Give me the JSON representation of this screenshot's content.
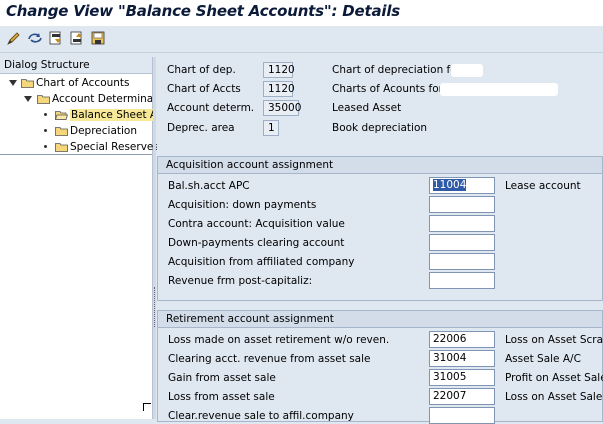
{
  "title": "Change View \"Balance Sheet Accounts\": Details",
  "toolbar": {
    "icons": [
      "edit-pencil-icon",
      "other-entry-icon",
      "previous-entry-icon",
      "next-entry-icon",
      "save-variant-icon"
    ]
  },
  "dialog": {
    "header": "Dialog Structure",
    "tree": [
      {
        "label": "Chart of Accounts"
      },
      {
        "label": "Account Determinati"
      },
      {
        "label": "Balance Sheet Ac"
      },
      {
        "label": "Depreciation"
      },
      {
        "label": "Special Reserves"
      }
    ]
  },
  "header_fields": [
    {
      "label": "Chart of dep.",
      "value": "1120",
      "desc": "Chart of depreciation for"
    },
    {
      "label": "Chart of Accts",
      "value": "1120",
      "desc": "Charts of Acounts for"
    },
    {
      "label": "Account determ.",
      "value": "35000",
      "desc": "Leased Asset"
    },
    {
      "label": "Deprec. area",
      "value": "1",
      "desc": "Book depreciation"
    }
  ],
  "acquisition": {
    "title": "Acquisition account assignment",
    "rows": [
      {
        "label": "Bal.sh.acct APC",
        "value": "11004",
        "desc": "Lease account"
      },
      {
        "label": "Acquisition: down payments",
        "value": "",
        "desc": ""
      },
      {
        "label": "Contra account: Acquisition value",
        "value": "",
        "desc": ""
      },
      {
        "label": "Down-payments clearing account",
        "value": "",
        "desc": ""
      },
      {
        "label": "Acquisition from affiliated company",
        "value": "",
        "desc": ""
      },
      {
        "label": "Revenue frm post-capitaliz:",
        "value": "",
        "desc": ""
      }
    ]
  },
  "retirement": {
    "title": "Retirement account assignment",
    "rows": [
      {
        "label": "Loss made on asset retirement w/o reven.",
        "value": "22006",
        "desc": "Loss on Asset Scrap"
      },
      {
        "label": "Clearing acct. revenue from asset sale",
        "value": "31004",
        "desc": "Asset Sale A/C"
      },
      {
        "label": "Gain from asset sale",
        "value": "31005",
        "desc": "Profit on Asset Sale"
      },
      {
        "label": "Loss from asset sale",
        "value": "22007",
        "desc": "Loss on Asset Sale"
      },
      {
        "label": "Clear.revenue sale to affil.company",
        "value": "",
        "desc": ""
      }
    ]
  }
}
